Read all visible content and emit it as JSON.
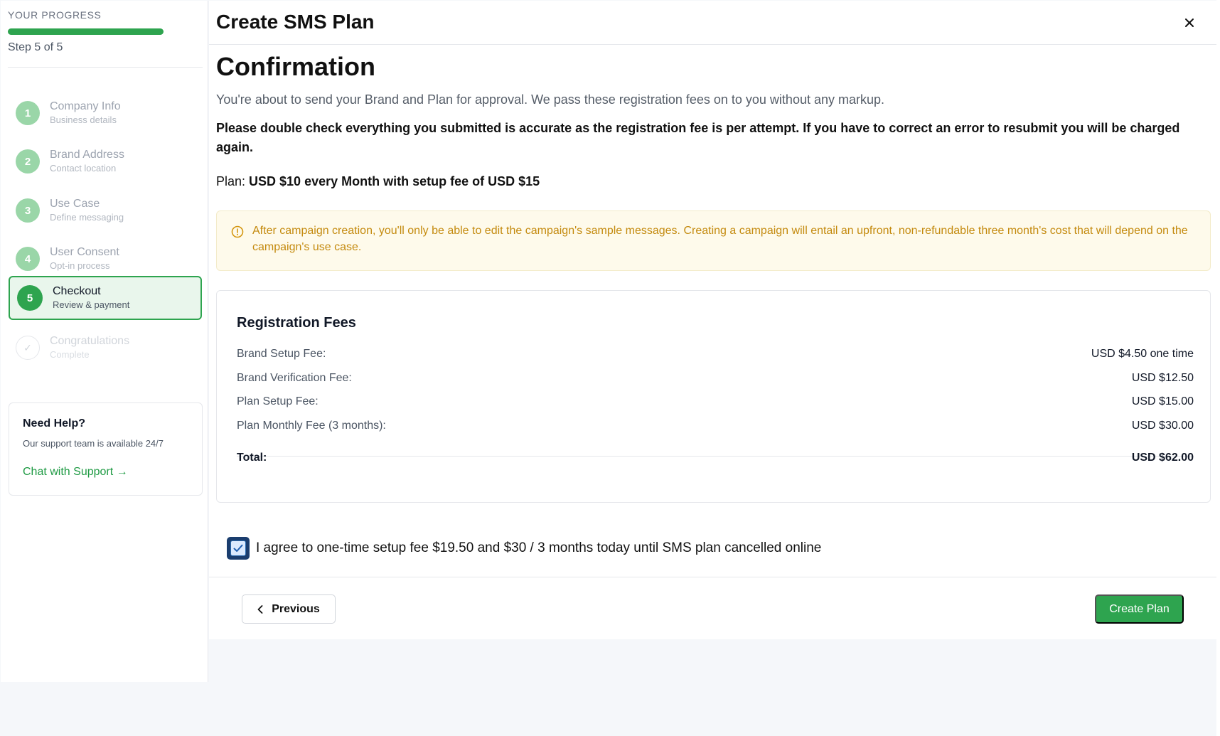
{
  "sidebar": {
    "progress_label": "YOUR PROGRESS",
    "progress_fraction": 1.0,
    "step_count": "Step 5 of 5",
    "steps": [
      {
        "num": "1",
        "title": "Company Info",
        "subtitle": "Business details",
        "state": "completed"
      },
      {
        "num": "2",
        "title": "Brand Address",
        "subtitle": "Contact location",
        "state": "completed"
      },
      {
        "num": "3",
        "title": "Use Case",
        "subtitle": "Define messaging",
        "state": "completed"
      },
      {
        "num": "4",
        "title": "User Consent",
        "subtitle": "Opt-in process",
        "state": "completed"
      },
      {
        "num": "5",
        "title": "Checkout",
        "subtitle": "Review & payment",
        "state": "active"
      },
      {
        "num": "✓",
        "title": "Congratulations",
        "subtitle": "Complete",
        "state": "pending"
      }
    ],
    "help": {
      "title": "Need Help?",
      "text": "Our support team is available 24/7",
      "link": "Chat with Support →"
    }
  },
  "modal": {
    "title": "Create SMS Plan",
    "close_icon": "close-icon",
    "heading": "Confirmation",
    "intro": "You're about to send your Brand and Plan for approval. We pass these registration fees on to you without any markup.",
    "warning": "Please double check everything you submitted is accurate as the registration fee is per attempt. If you have to correct an error to resubmit you will be charged again.",
    "plan_label": "Plan: ",
    "plan_value": "USD $10 every Month with setup fee of USD $15",
    "alert": {
      "icon": "info-circle-icon",
      "text": "After campaign creation, you'll only be able to edit the campaign's sample messages. Creating a campaign will entail an upfront, non-refundable three month's cost that will depend on the campaign's use case."
    },
    "fees": {
      "title": "Registration Fees",
      "rows": [
        {
          "label": "Brand Setup Fee:",
          "value": "USD $4.50 one time"
        },
        {
          "label": "Brand Verification Fee:",
          "value": "USD $12.50"
        },
        {
          "label": "Plan Setup Fee:",
          "value": "USD $15.00"
        },
        {
          "label": "Plan Monthly Fee (3 months):",
          "value": "USD $30.00"
        }
      ],
      "total_label": "Total:",
      "total_value": "USD $62.00"
    },
    "agreement": {
      "checked": true,
      "text": "I agree to one-time setup fee $19.50 and $30 / 3 months today until SMS plan cancelled online"
    },
    "buttons": {
      "previous": "Previous",
      "create": "Create Plan"
    }
  },
  "colors": {
    "accent_green": "#2ea44f",
    "alert_text": "#c48a0e",
    "alert_bg": "#fefaeb",
    "checkbox_dark": "#1a3d6e"
  }
}
